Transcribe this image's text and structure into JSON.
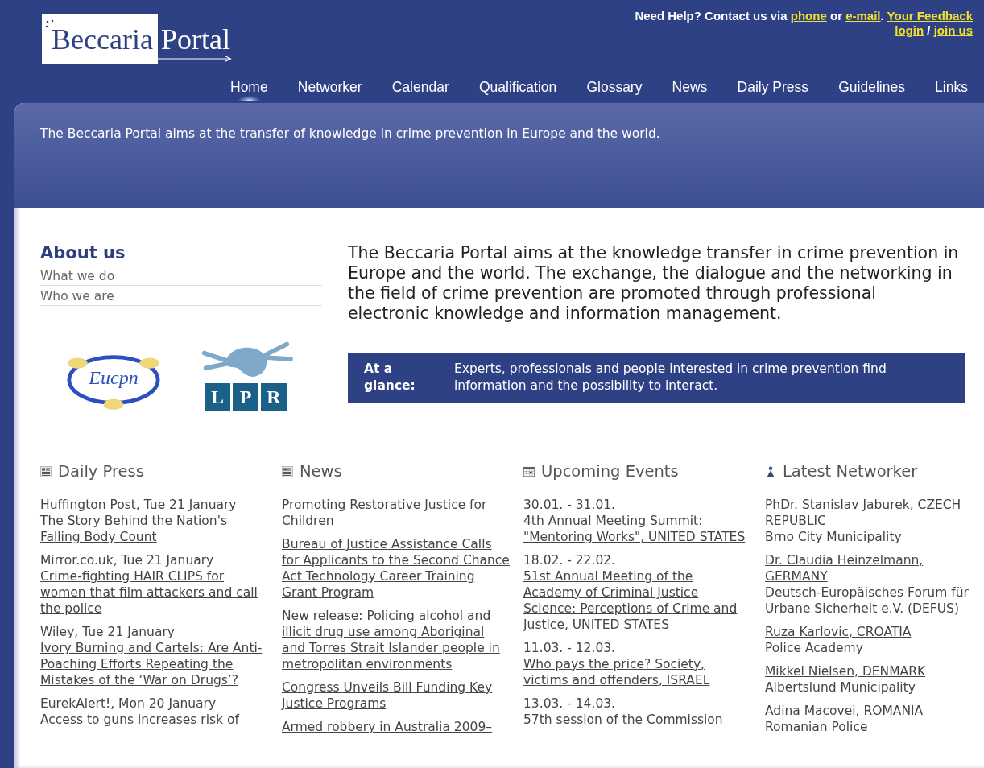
{
  "header": {
    "logo": {
      "word1": "Beccaria",
      "word2": "Portal"
    },
    "help_line": [
      {
        "kind": "text",
        "text": "Need Help? Contact us via "
      },
      {
        "kind": "link",
        "text": "phone"
      },
      {
        "kind": "text",
        "text": " or "
      },
      {
        "kind": "link",
        "text": "e-mail"
      },
      {
        "kind": "text",
        "text": ". "
      },
      {
        "kind": "link",
        "text": "Your Feedback"
      }
    ],
    "account_line": [
      {
        "kind": "link",
        "text": "login"
      },
      {
        "kind": "text",
        "text": " / "
      },
      {
        "kind": "link",
        "text": "join us"
      }
    ]
  },
  "nav": [
    {
      "label": "Home",
      "selected": true
    },
    {
      "label": "Networker",
      "selected": false
    },
    {
      "label": "Calendar",
      "selected": false
    },
    {
      "label": "Qualification",
      "selected": false
    },
    {
      "label": "Glossary",
      "selected": false
    },
    {
      "label": "News",
      "selected": false
    },
    {
      "label": "Daily Press",
      "selected": false
    },
    {
      "label": "Guidelines",
      "selected": false
    },
    {
      "label": "Links",
      "selected": false
    }
  ],
  "tagline": "The Beccaria Portal aims at the transfer of knowledge in crime prevention in Europe and the world.",
  "about": {
    "title": "About us",
    "links": [
      "What we do",
      "Who we are"
    ]
  },
  "partner_logos": {
    "eucpn": "Eucpn",
    "lpr": [
      "L",
      "P",
      "R"
    ]
  },
  "intro": "The Beccaria Portal aims at the knowledge transfer in crime prevention in Europe and the world. The exchange, the dialogue and the networking in the field of crime prevention are promoted through professional electronic knowledge and information management.",
  "glance": {
    "label": "At a glance:",
    "text": "Experts, professionals and people interested in crime prevention find information and the possibility to interact."
  },
  "sections": [
    {
      "kind": "press",
      "title": "Daily Press",
      "items": [
        {
          "meta": "Huffington Post, Tue 21 January",
          "link": "The Story Behind the Nation's Falling Body Count"
        },
        {
          "meta": "Mirror.co.uk, Tue 21 January",
          "link": "Crime-fighting HAIR CLIPS for women that film attackers and call the police"
        },
        {
          "meta": "Wiley, Tue 21 January",
          "link": "Ivory Burning and Cartels: Are Anti-Poaching Efforts Repeating the Mistakes of the ‘War on Drugs’?"
        },
        {
          "meta": "EurekAlert!, Mon 20 January",
          "link": "Access to guns increases risk of"
        }
      ]
    },
    {
      "kind": "news",
      "title": "News",
      "items": [
        {
          "link": "Promoting Restorative Justice for Children"
        },
        {
          "link": "Bureau of Justice Assistance Calls for Applicants to the Second Chance Act Technology Career Training Grant Program"
        },
        {
          "link": "New release: Policing alcohol and illicit drug use among Aboriginal and Torres Strait Islander people in metropolitan environments"
        },
        {
          "link": "Congress Unveils Bill Funding Key Justice Programs"
        },
        {
          "link": "Armed robbery in Australia 2009–"
        }
      ]
    },
    {
      "kind": "events",
      "title": "Upcoming Events",
      "items": [
        {
          "meta": "30.01. - 31.01.",
          "link": "4th Annual Meeting Summit: \"Mentoring Works\", UNITED STATES"
        },
        {
          "meta": "18.02. - 22.02.",
          "link": "51st Annual Meeting of the Academy of Criminal Justice Science: Perceptions of Crime and Justice, UNITED STATES"
        },
        {
          "meta": "11.03. - 12.03.",
          "link": "Who pays the price? Society, victims and offenders, ISRAEL"
        },
        {
          "meta": "13.03. - 14.03.",
          "link": "57th session of the Commission"
        }
      ]
    },
    {
      "kind": "networker",
      "title": "Latest Networker",
      "items": [
        {
          "link": "PhDr. Stanislav Jaburek, CZECH REPUBLIC",
          "note": "Brno City Municipality"
        },
        {
          "link": "Dr. Claudia Heinzelmann, GERMANY",
          "note": "Deutsch-Europäisches Forum für Urbane Sicherheit e.V. (DEFUS)"
        },
        {
          "link": "Ruza Karlovic, CROATIA",
          "note": "Police Academy"
        },
        {
          "link": "Mikkel Nielsen, DENMARK",
          "note": "Albertslund Municipality"
        },
        {
          "link": "Adina Macovei, ROMANIA",
          "note": "Romanian Police"
        }
      ]
    }
  ]
}
